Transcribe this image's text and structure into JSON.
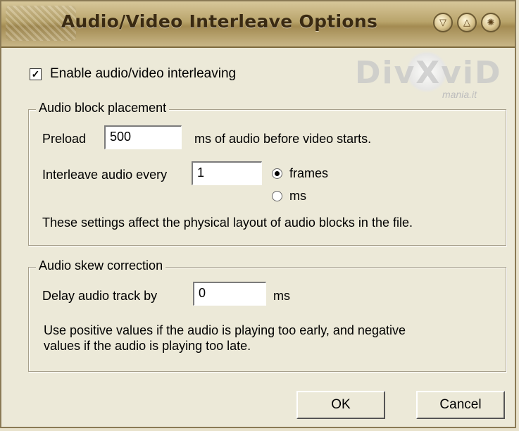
{
  "window": {
    "title": "Audio/Video Interleave Options"
  },
  "titlebar_buttons": [
    {
      "icon": "triangle-help-icon"
    },
    {
      "icon": "triangle-up-icon"
    },
    {
      "icon": "spiral-close-icon"
    }
  ],
  "watermark": {
    "text": "DivXviD",
    "sub": "mania.it"
  },
  "enable_interleave": {
    "label": "Enable audio/video interleaving",
    "checked": true
  },
  "audio_block": {
    "legend": "Audio block placement",
    "preload_label": "Preload",
    "preload_value": "500",
    "preload_suffix": "ms of audio before video starts.",
    "interleave_label": "Interleave audio every",
    "interleave_value": "1",
    "unit_frames": "frames",
    "unit_ms": "ms",
    "note": "These settings affect the physical layout of audio blocks in the file."
  },
  "skew": {
    "legend": "Audio skew correction",
    "delay_label": "Delay audio track by",
    "delay_value": "0",
    "delay_suffix": "ms",
    "note_line1": "Use positive values if the audio is playing too early, and negative",
    "note_line2": "values if the audio is playing too late."
  },
  "buttons": {
    "ok": "OK",
    "cancel": "Cancel"
  }
}
